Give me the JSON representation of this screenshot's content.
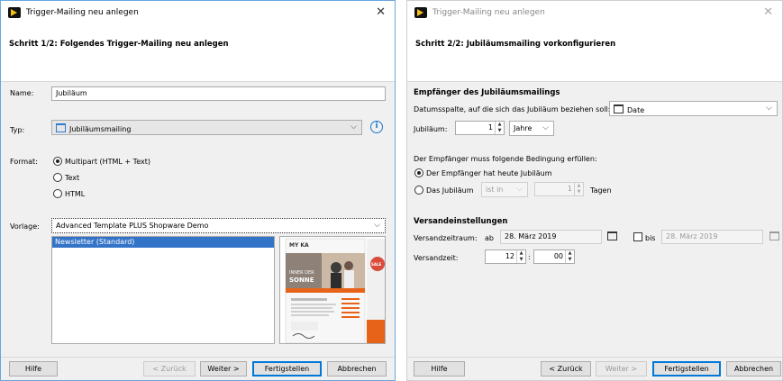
{
  "dialog1": {
    "title": "Trigger-Mailing neu anlegen",
    "step_title": "Schritt 1/2: Folgendes Trigger-Mailing neu anlegen",
    "name_label": "Name:",
    "name_value": "Jubiläum",
    "type_label": "Typ:",
    "type_value": "Jubiläumsmailing",
    "format_label": "Format:",
    "format_options": [
      "Multipart (HTML + Text)",
      "Text",
      "HTML"
    ],
    "format_selected": "Multipart (HTML + Text)",
    "template_label": "Vorlage:",
    "template_value": "Advanced Template PLUS Shopware Demo",
    "template_list": [
      "Newsletter (Standard)"
    ],
    "template_list_selected": "Newsletter (Standard)",
    "preview": {
      "brand": "MY KA",
      "headline_1": "INNER DER",
      "headline_2": "SONNE",
      "badge": "SALE"
    },
    "buttons": {
      "help": "Hilfe",
      "back": "< Zurück",
      "next": "Weiter >",
      "finish": "Fertigstellen",
      "cancel": "Abbrechen"
    }
  },
  "dialog2": {
    "title": "Trigger-Mailing neu anlegen",
    "step_title": "Schritt 2/2: Jubiläumsmailing vorkonfigurieren",
    "recipients_heading": "Empfänger des Jubiläumsmailings",
    "date_column_label": "Datumsspalte, auf die sich das Jubiläum beziehen soll:",
    "date_column_value": "Date",
    "anniversary_label": "Jubiläum:",
    "anniversary_value": "1",
    "anniversary_unit": "Jahre",
    "condition_label": "Der Empfänger muss folgende Bedingung erfüllen:",
    "condition_today": "Der Empfänger hat heute Jubiläum",
    "condition_in": "Das Jubiläum",
    "condition_in_select": "ist in",
    "condition_days_value": "1",
    "condition_days_unit": "Tagen",
    "dispatch_heading": "Versandeinstellungen",
    "dispatch_period_label": "Versandzeitraum:",
    "from_label": "ab",
    "from_date": "28. März 2019",
    "until_label": "bis",
    "until_date": "28. März 2019",
    "dispatch_time_label": "Versandzeit:",
    "hour": "12",
    "time_sep": ":",
    "minute": "00",
    "buttons": {
      "help": "Hilfe",
      "back": "< Zurück",
      "next": "Weiter >",
      "finish": "Fertigstellen",
      "cancel": "Abbrechen"
    }
  },
  "colors": {
    "selection": "#3373c8",
    "accent": "#1f77d0",
    "preview_orange": "#e8631a"
  }
}
